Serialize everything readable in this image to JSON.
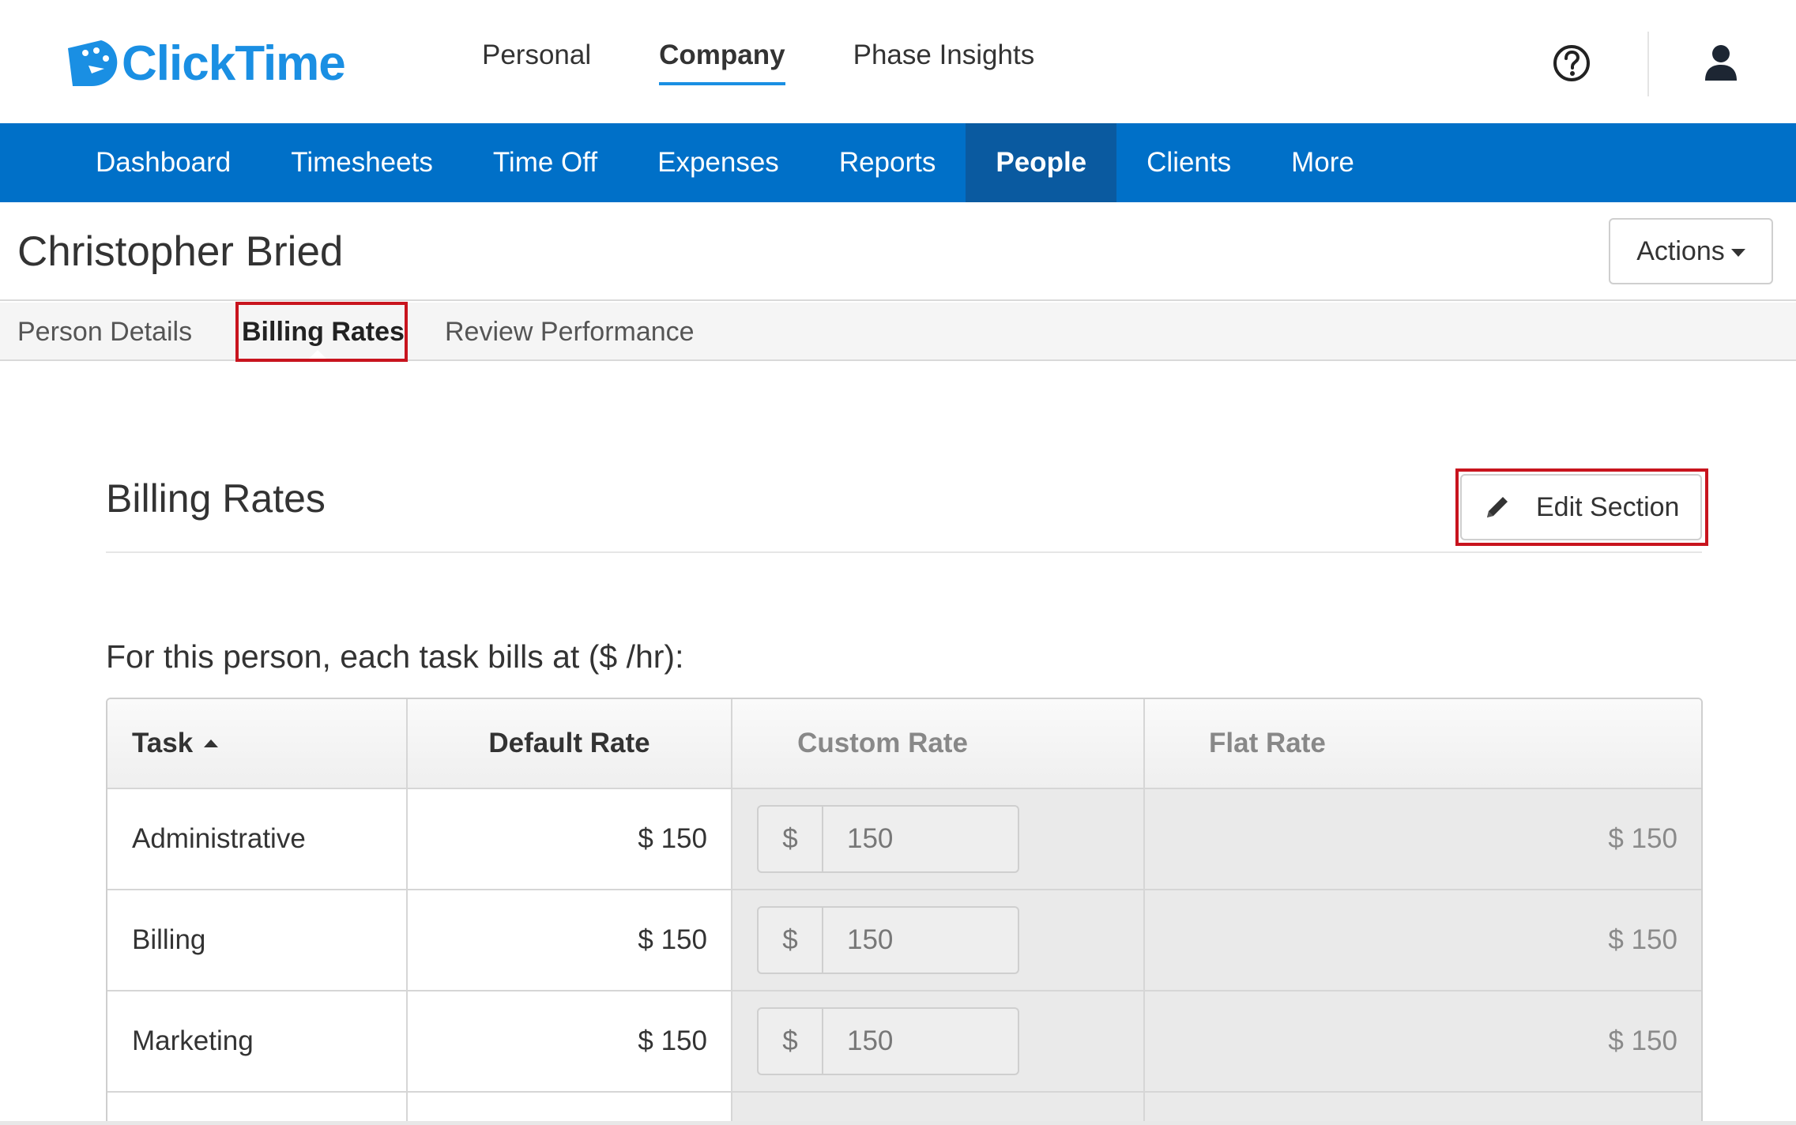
{
  "brand": {
    "name": "ClickTime",
    "color": "#1a8fe3",
    "icon": "clicktime-logo-icon"
  },
  "top_nav": [
    {
      "label": "Personal",
      "active": false
    },
    {
      "label": "Company",
      "active": true
    },
    {
      "label": "Phase Insights",
      "active": false
    }
  ],
  "top_icons": {
    "help": "help-circle-icon",
    "user": "user-icon"
  },
  "main_nav": [
    {
      "label": "Dashboard",
      "active": false
    },
    {
      "label": "Timesheets",
      "active": false
    },
    {
      "label": "Time Off",
      "active": false
    },
    {
      "label": "Expenses",
      "active": false
    },
    {
      "label": "Reports",
      "active": false
    },
    {
      "label": "People",
      "active": true
    },
    {
      "label": "Clients",
      "active": false
    },
    {
      "label": "More",
      "active": false
    }
  ],
  "person": {
    "name": "Christopher Bried",
    "actions_label": "Actions"
  },
  "sub_tabs": [
    {
      "label": "Person Details",
      "active": false
    },
    {
      "label": "Billing Rates",
      "active": true
    },
    {
      "label": "Review Performance",
      "active": false
    }
  ],
  "section": {
    "title": "Billing Rates",
    "edit_label": "Edit Section",
    "intro": "For this person, each task bills at ($ /hr):"
  },
  "table": {
    "headers": {
      "task": "Task",
      "default": "Default Rate",
      "custom": "Custom Rate",
      "flat": "Flat Rate"
    },
    "currency_symbol": "$",
    "rows": [
      {
        "task": "Administrative",
        "default": "$ 150",
        "custom": "150",
        "flat": "$ 150"
      },
      {
        "task": "Billing",
        "default": "$ 150",
        "custom": "150",
        "flat": "$ 150"
      },
      {
        "task": "Marketing",
        "default": "$ 150",
        "custom": "150",
        "flat": "$ 150"
      }
    ]
  },
  "colors": {
    "nav_blue": "#0070c8",
    "nav_active": "#0a5aa0",
    "highlight_red": "#c8141e"
  }
}
